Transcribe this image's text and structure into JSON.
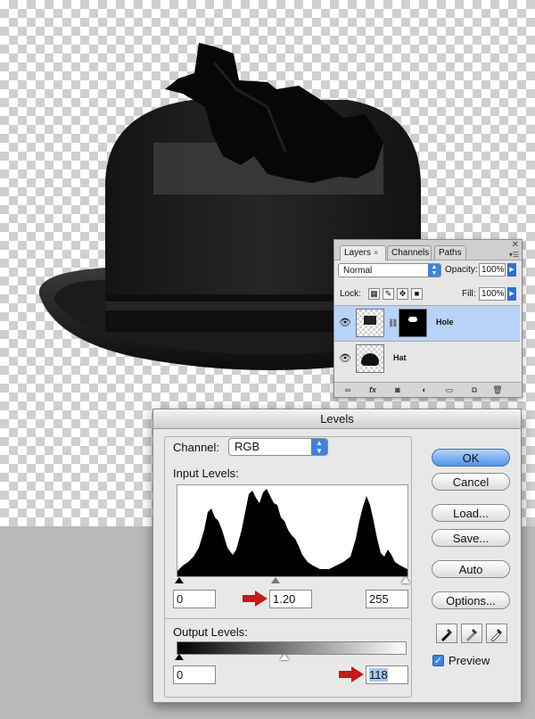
{
  "layers_panel": {
    "tabs": [
      {
        "label": "Layers",
        "close": "×"
      },
      {
        "label": "Channels"
      },
      {
        "label": "Paths"
      }
    ],
    "blend_mode": "Normal",
    "opacity_label": "Opacity:",
    "opacity_value": "100%",
    "lock_label": "Lock:",
    "fill_label": "Fill:",
    "fill_value": "100%",
    "layers": [
      {
        "name": "Hole",
        "selected": true,
        "icon": "eye-icon"
      },
      {
        "name": "Hat",
        "selected": false,
        "icon": "eye-icon"
      }
    ],
    "footer_icons": [
      "link-icon",
      "fx-icon",
      "mask-icon",
      "adjustment-icon",
      "folder-icon",
      "new-layer-icon",
      "trash-icon"
    ],
    "fx_label": "fx"
  },
  "levels_dialog": {
    "title": "Levels",
    "channel_label": "Channel:",
    "channel_value": "RGB",
    "input_levels_label": "Input Levels:",
    "input_black": "0",
    "input_gamma": "1.20",
    "input_white": "255",
    "output_levels_label": "Output Levels:",
    "output_black": "0",
    "output_white": "118",
    "buttons": {
      "ok": "OK",
      "cancel": "Cancel",
      "load": "Load...",
      "save": "Save...",
      "auto": "Auto",
      "options": "Options..."
    },
    "preview_label": "Preview",
    "preview_checked": true,
    "accent_color": "#3c83e0",
    "arrow_color": "#c41a1a"
  }
}
